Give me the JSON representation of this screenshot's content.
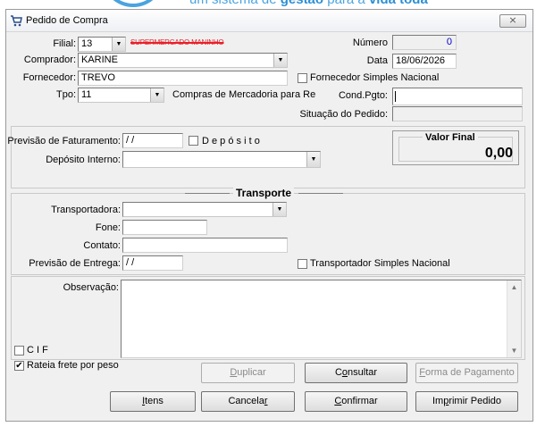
{
  "banner": {
    "text_a": "um sistema de ",
    "text_b": "gestão",
    "text_c": " para a ",
    "text_d": "vida toda"
  },
  "window": {
    "title": "Pedido de Compra",
    "close_label": "⨯"
  },
  "header": {
    "filial_label": "Filial:",
    "filial_value": "13",
    "filial_name": "SUPERMERCADO MANINHO",
    "comprador_label": "Comprador:",
    "comprador_value": "KARINE",
    "fornecedor_label": "Fornecedor:",
    "fornecedor_value": "TREVO",
    "tpo_label": "Tpo:",
    "tpo_value": "11",
    "tpo_desc": "Compras de Mercadoria para Re",
    "numero_label": "Número",
    "numero_value": "0",
    "data_label": "Data",
    "data_value": "18/06/2026",
    "fornecedor_simples_label": "Fornecedor Simples Nacional",
    "cond_pgto_label": "Cond.Pgto:",
    "cond_pgto_value": "",
    "situacao_label": "Situação do Pedido:",
    "situacao_value": ""
  },
  "faturamento": {
    "previsao_label": "Previsão de Faturamento:",
    "previsao_value": " / /",
    "deposito_label": "D e p ó s i t o",
    "deposito_interno_label": "Depósito Interno:",
    "deposito_interno_value": "",
    "valor_final_label": "Valor Final",
    "valor_final_value": "0,00"
  },
  "transporte": {
    "title": "Transporte",
    "transportadora_label": "Transportadora:",
    "transportadora_value": "",
    "fone_label": "Fone:",
    "fone_value": "",
    "contato_label": "Contato:",
    "contato_value": "",
    "previsao_entrega_label": "Previsão de Entrega:",
    "previsao_entrega_value": " / /",
    "transportador_simples_label": "Transportador Simples Nacional"
  },
  "observacao": {
    "label": "Observação:",
    "value": ""
  },
  "cif": {
    "label": "C I F"
  },
  "rateia": {
    "label": "Rateia frete por peso",
    "checked": "✔"
  },
  "buttons": {
    "duplicar_u": "D",
    "duplicar_rest": "uplicar",
    "consultar_a": "C",
    "consultar_u": "o",
    "consultar_rest": "nsultar",
    "forma_u": "F",
    "forma_rest": "orma de Pagamento",
    "itens_u": "I",
    "itens_rest": "tens",
    "cancelar_a": "Cancela",
    "cancelar_u": "r",
    "confirmar_u": "C",
    "confirmar_rest": "onfirmar",
    "imprimir_a": "Im",
    "imprimir_u": "p",
    "imprimir_rest": "rimir Pedido"
  },
  "colors": {
    "accent": "#4aa3df",
    "strike": "#e8202a",
    "numero": "#0000cc"
  }
}
